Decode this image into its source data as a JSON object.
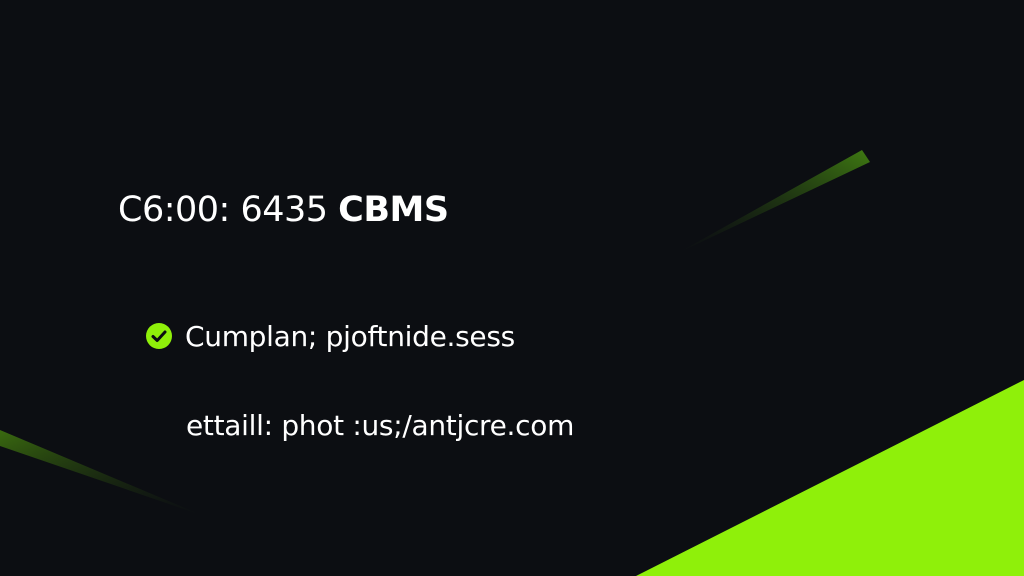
{
  "slide": {
    "title_regular": "C6:00: 6435 ",
    "title_bold": "CBMS",
    "check_item": {
      "icon": "check-circle-icon",
      "text": "Cumplan; pjoftnide.sess"
    },
    "email_line": "ettaill: phot :us;/antjcre.com"
  },
  "colors": {
    "background": "#0c0e12",
    "accent": "#8ff00a",
    "accent_dark": "#3a6a10",
    "text": "#ffffff"
  }
}
